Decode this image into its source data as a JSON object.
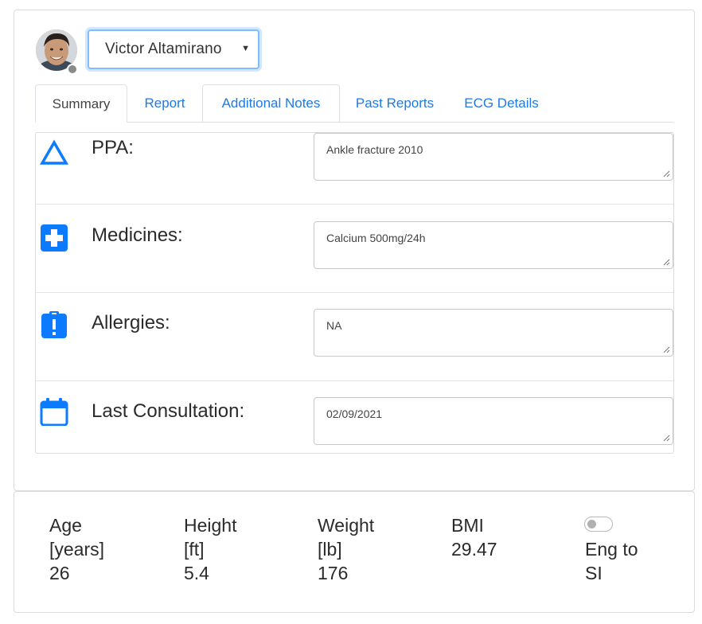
{
  "patient": {
    "selected_name": "Victor Altamirano",
    "status_color": "#8a8a8a"
  },
  "tabs": [
    {
      "label": "Summary",
      "active": true
    },
    {
      "label": "Report",
      "active": false
    },
    {
      "label": "Additional Notes",
      "active": false
    },
    {
      "label": "Past Reports",
      "active": false
    },
    {
      "label": "ECG Details",
      "active": false
    }
  ],
  "summary": {
    "rows": [
      {
        "label": "PPA:",
        "value": "Ankle fracture 2010",
        "icon": "triangle-outline-icon"
      },
      {
        "label": "Medicines:",
        "value": "Calcium 500mg/24h",
        "icon": "medical-plus-icon"
      },
      {
        "label": "Allergies:",
        "value": "NA",
        "icon": "clipboard-alert-icon"
      },
      {
        "label": "Last Consultation:",
        "value": "02/09/2021",
        "icon": "calendar-icon"
      }
    ]
  },
  "stats": {
    "age": {
      "label": "Age",
      "unit": "[years]",
      "value": "26"
    },
    "height": {
      "label": "Height",
      "unit": "[ft]",
      "value": "5.4"
    },
    "weight": {
      "label": "Weight",
      "unit": "[lb]",
      "value": "176"
    },
    "bmi": {
      "label": "BMI",
      "value": "29.47"
    },
    "units_toggle": {
      "label_line1": "Eng to",
      "label_line2": "SI",
      "checked": false
    }
  },
  "colors": {
    "accent": "#1e7ae6",
    "icon_blue": "#0d7bff",
    "focus_border": "#80bdff"
  }
}
